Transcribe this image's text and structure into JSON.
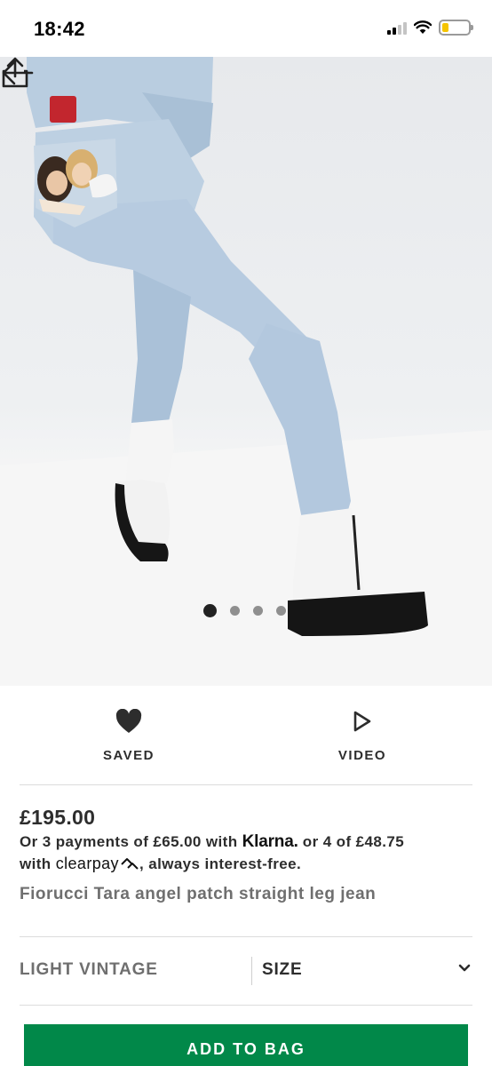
{
  "status_bar": {
    "time": "18:42",
    "icons": [
      "cellular-signal-icon",
      "wifi-icon",
      "battery-icon"
    ]
  },
  "image": {
    "carousel_total": 4,
    "carousel_active": 1,
    "icons": [
      "back-arrow-icon",
      "share-icon"
    ]
  },
  "actions": {
    "saved_label": "SAVED",
    "video_label": "VIDEO",
    "icons": [
      "heart-filled-icon",
      "play-outline-icon"
    ]
  },
  "product": {
    "price": "£195.00",
    "payments_part1": "Or 3 payments of £65.00 with ",
    "klarna": "Klarna.",
    "payments_part2": " or 4 of £48.75",
    "payments_part3": "with ",
    "clearpay": "clearpay",
    "payments_part4": ", always interest-free.",
    "name": "Fiorucci Tara angel patch straight leg jean"
  },
  "options": {
    "colour": "LIGHT VINTAGE",
    "size_label": "SIZE",
    "icons": [
      "chevron-down-icon"
    ]
  },
  "cta": {
    "add_to_bag": "ADD TO BAG"
  },
  "colors": {
    "accent_green": "#018849",
    "text_dark": "#2d2d2d",
    "text_muted": "#6f6f6f"
  }
}
